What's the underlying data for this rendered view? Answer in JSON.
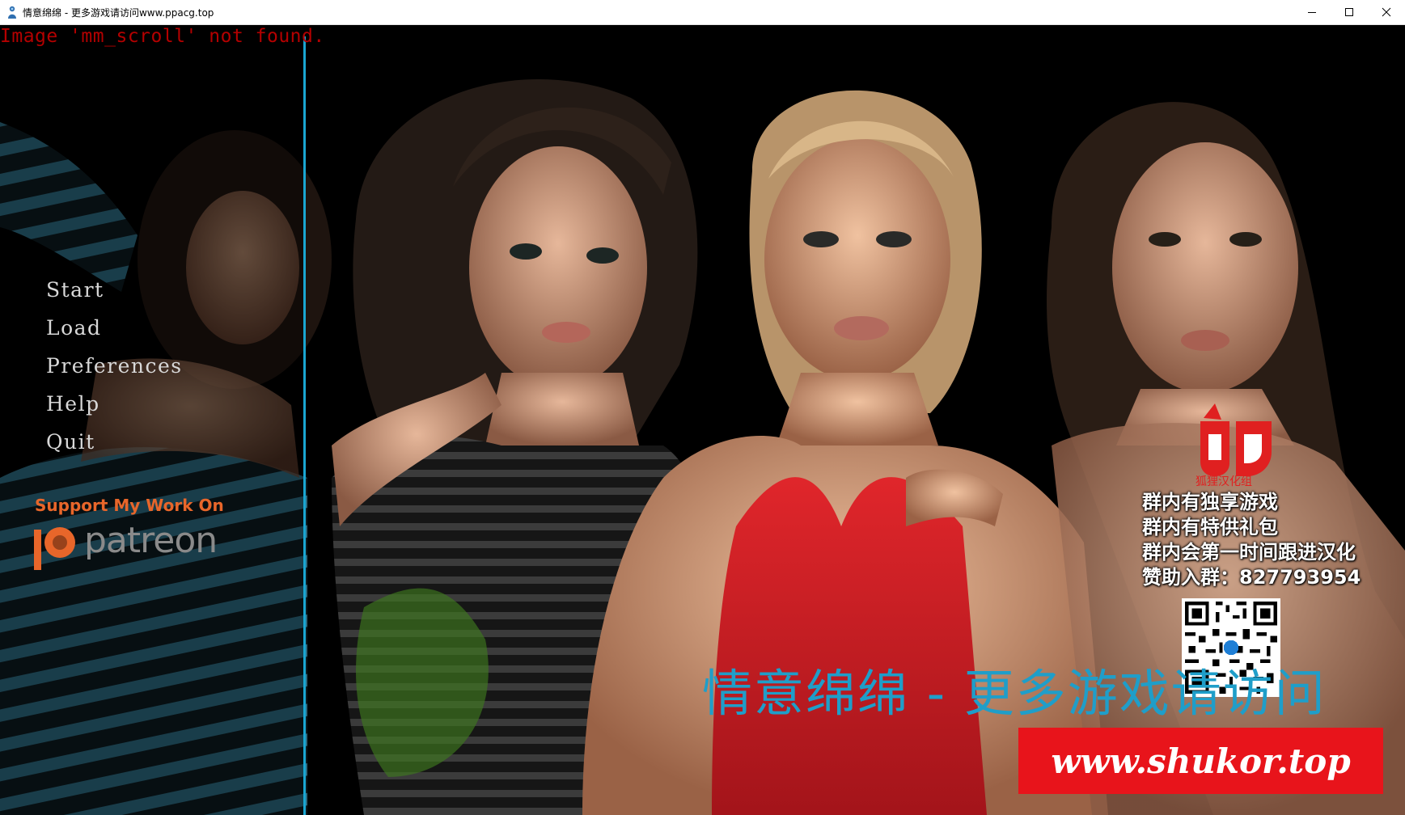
{
  "window": {
    "title": "情意绵绵 - 更多游戏请访问www.ppacg.top"
  },
  "error_message": "Image 'mm_scroll' not found.",
  "main_menu": {
    "items": [
      {
        "label": "Start"
      },
      {
        "label": "Load"
      },
      {
        "label": "Preferences"
      },
      {
        "label": "Help"
      },
      {
        "label": "Quit"
      }
    ]
  },
  "support": {
    "heading": "Support My Work On",
    "brand": "patreon"
  },
  "promo": {
    "logo_text": "狐狸汉化组",
    "lines": [
      "群内有独享游戏",
      "群内有特供礼包",
      "群内会第一时间跟进汉化",
      "赞助入群：827793954"
    ]
  },
  "watermark": {
    "banner_text": "情意绵绵 - 更多游戏请访问",
    "url": "www.shukor.top"
  },
  "colors": {
    "menu_divider": "#1aa6d2",
    "error_red": "#b40000",
    "patreon_orange": "#e8662a",
    "banner_blue": "#1f9ec9",
    "url_red": "#e8141b"
  }
}
